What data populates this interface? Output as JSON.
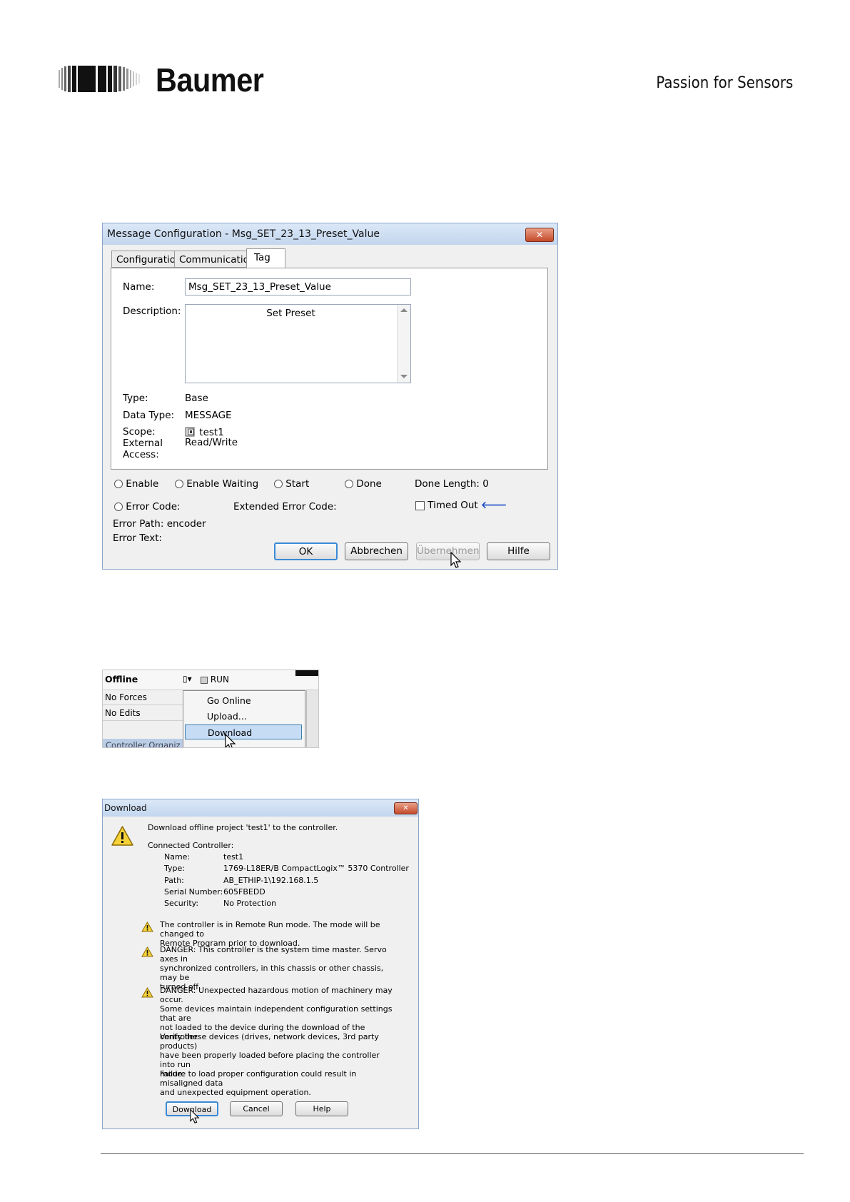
{
  "header": {
    "brand": "Baumer",
    "tagline": "Passion for Sensors"
  },
  "message_config": {
    "title": "Message Configuration - Msg_SET_23_13_Preset_Value",
    "tabs": [
      {
        "label": "Configuration"
      },
      {
        "label": "Communication"
      },
      {
        "label": "Tag"
      }
    ],
    "name_label": "Name:",
    "name_value": "Msg_SET_23_13_Preset_Value",
    "description_label": "Description:",
    "description_value": "Set Preset",
    "type_label": "Type:",
    "type_value": "Base",
    "data_type_label": "Data Type:",
    "data_type_value": "MESSAGE",
    "scope_label": "Scope:",
    "scope_value": "test1",
    "external_label_1": "External",
    "external_label_2": "Access:",
    "external_value": "Read/Write",
    "status": {
      "enable": "Enable",
      "enable_waiting": "Enable Waiting",
      "start": "Start",
      "done": "Done",
      "done_length": "Done Length:  0",
      "error_code": "Error Code:",
      "extended_error_code": "Extended Error Code:",
      "timed_out": "Timed Out",
      "error_path": "Error Path:  encoder",
      "error_text": "Error Text:"
    },
    "buttons": {
      "ok": "OK",
      "cancel": "Abbrechen",
      "apply": "Übernehmen",
      "help": "Hilfe"
    }
  },
  "controller_menu": {
    "status": "Offline",
    "run": "RUN",
    "forces": "No Forces",
    "edits": "No Edits",
    "organizer": "Controller Organiz",
    "items": [
      {
        "label": "Go Online"
      },
      {
        "label": "Upload..."
      },
      {
        "label": "Download"
      }
    ]
  },
  "download_dialog": {
    "title": "Download",
    "intro": "Download offline project 'test1' to the controller.",
    "connected_controller": "Connected Controller:",
    "details": [
      {
        "key": "Name:",
        "value": "test1"
      },
      {
        "key": "Type:",
        "value": "1769-L18ER/B CompactLogix™ 5370 Controller"
      },
      {
        "key": "Path:",
        "value": "AB_ETHIP-1\\192.168.1.5"
      },
      {
        "key": "Serial Number:",
        "value": "605FBEDD"
      },
      {
        "key": "Security:",
        "value": "No Protection"
      }
    ],
    "warnings": [
      {
        "line1": "The controller is in Remote Run mode. The mode will be changed to",
        "line2": "Remote Program prior to download.",
        "line3": ""
      },
      {
        "line1": "DANGER: This controller is the system time master.  Servo axes in",
        "line2": "synchronized controllers, in this chassis or other chassis, may be",
        "line3": "turned off."
      },
      {
        "line1": "DANGER: Unexpected hazardous motion of machinery may occur.",
        "line2": "",
        "line3": ""
      }
    ],
    "paragraphs": [
      {
        "line1": "Some devices maintain independent configuration settings that are",
        "line2": "not loaded to the device during the download of the controller.",
        "line3": ""
      },
      {
        "line1": "Verify these devices (drives, network devices, 3rd party products)",
        "line2": "have been properly loaded before placing the controller into run",
        "line3": "mode."
      },
      {
        "line1": "Failure to load proper configuration could result in misaligned data",
        "line2": "and unexpected equipment operation.",
        "line3": ""
      }
    ],
    "buttons": {
      "download": "Download",
      "cancel": "Cancel",
      "help": "Help"
    }
  }
}
